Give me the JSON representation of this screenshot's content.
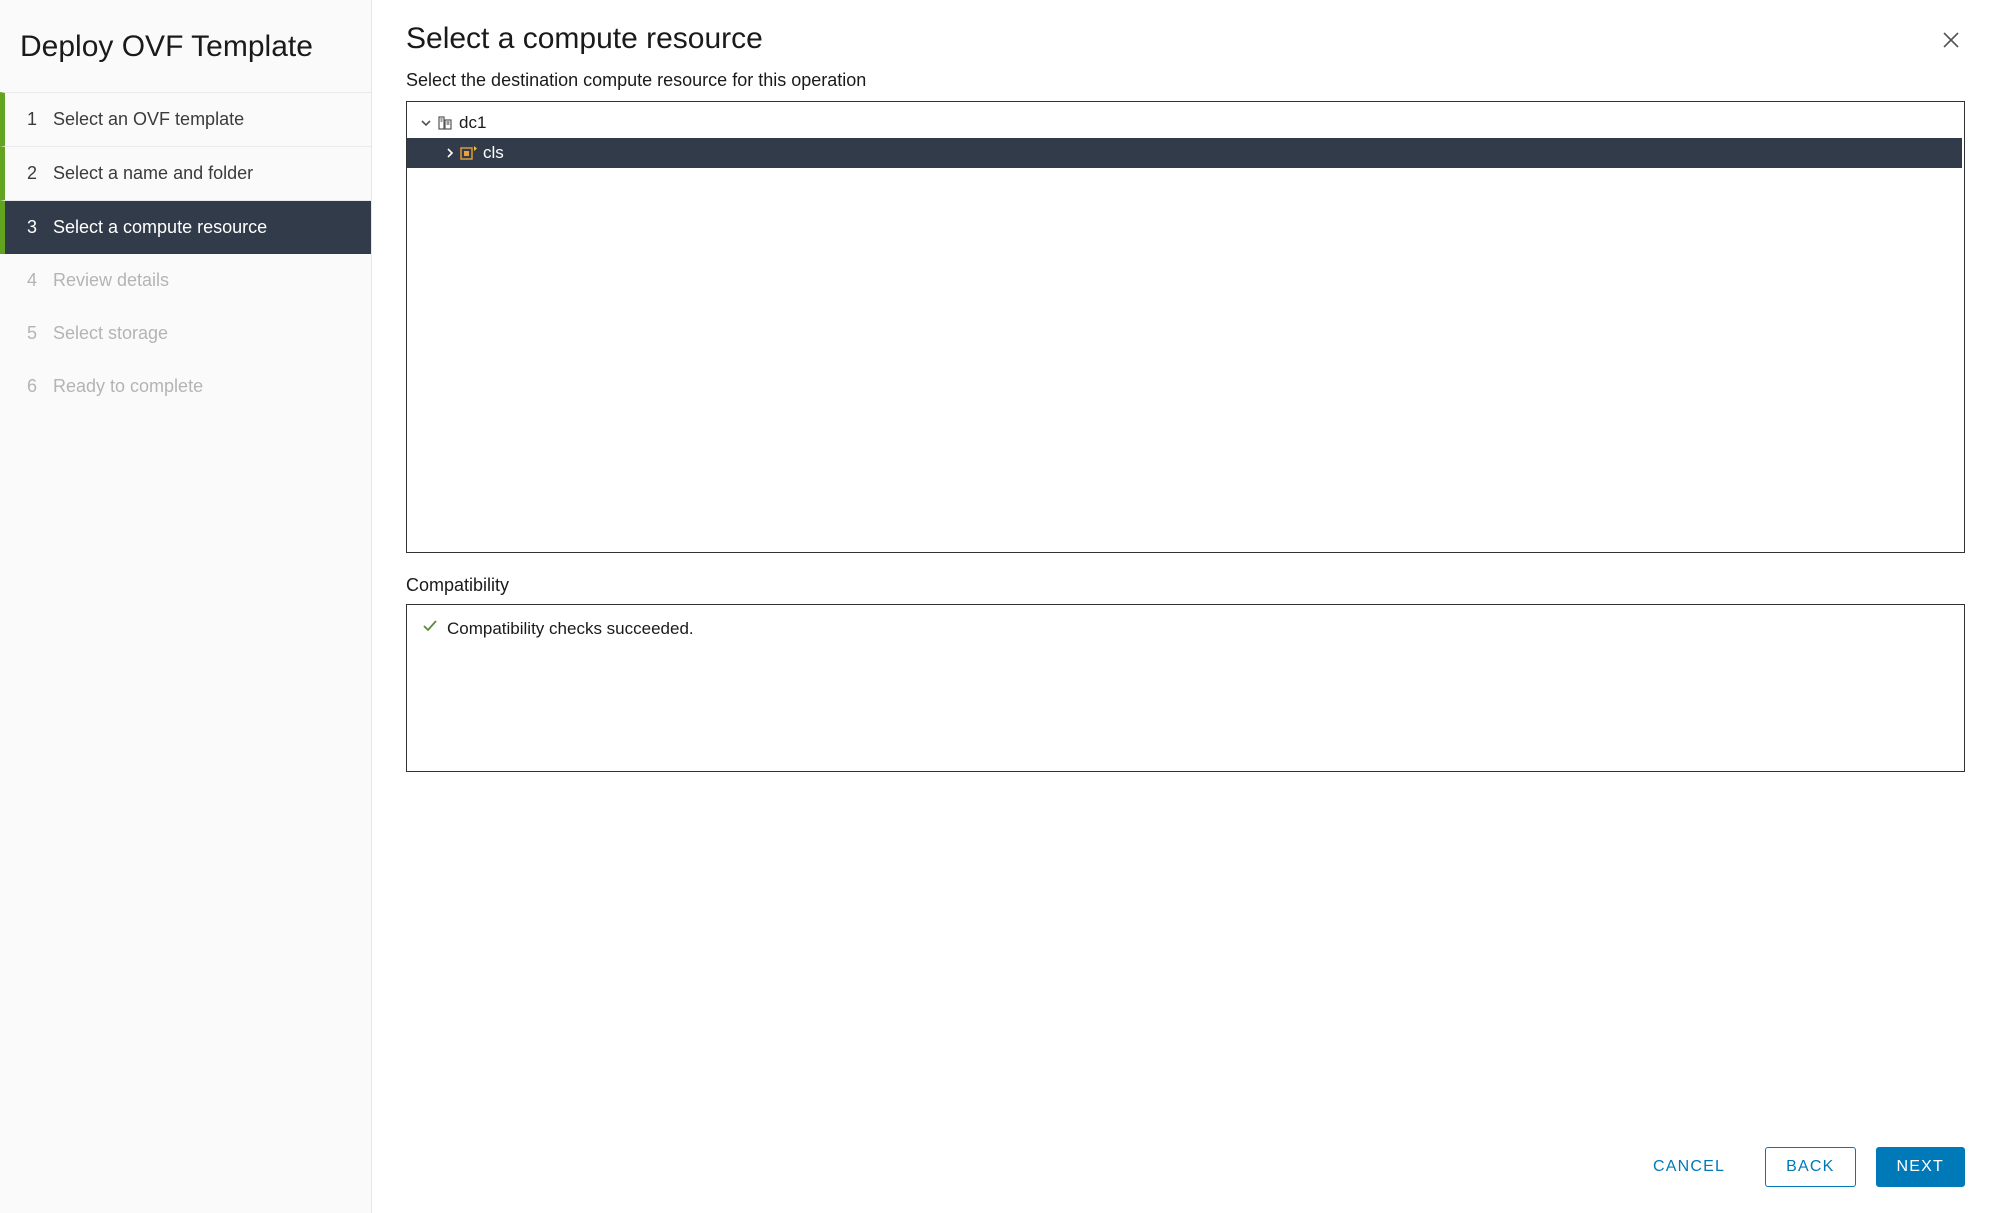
{
  "sidebar": {
    "title": "Deploy OVF Template",
    "steps": [
      {
        "num": "1",
        "label": "Select an OVF template",
        "state": "completed"
      },
      {
        "num": "2",
        "label": "Select a name and folder",
        "state": "completed"
      },
      {
        "num": "3",
        "label": "Select a compute resource",
        "state": "active"
      },
      {
        "num": "4",
        "label": "Review details",
        "state": "future"
      },
      {
        "num": "5",
        "label": "Select storage",
        "state": "future"
      },
      {
        "num": "6",
        "label": "Ready to complete",
        "state": "future"
      }
    ]
  },
  "main": {
    "heading": "Select a compute resource",
    "subtitle": "Select the destination compute resource for this operation",
    "tree": {
      "root": {
        "label": "dc1",
        "expanded": true
      },
      "child": {
        "label": "cls",
        "expanded": false,
        "selected": true
      }
    },
    "compat": {
      "label": "Compatibility",
      "message": "Compatibility checks succeeded."
    }
  },
  "footer": {
    "cancel": "CANCEL",
    "back": "BACK",
    "next": "NEXT"
  }
}
